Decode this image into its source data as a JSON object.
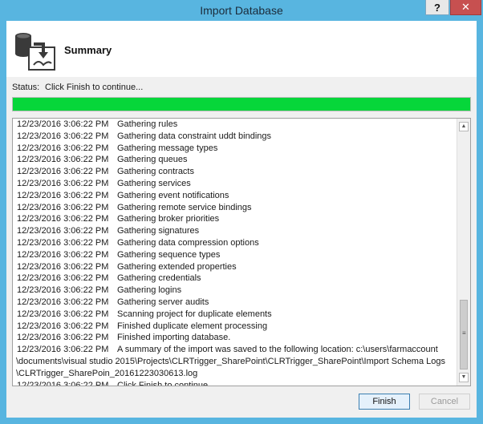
{
  "window": {
    "title": "Import Database",
    "help_label": "?",
    "close_label": "✕"
  },
  "header": {
    "title": "Summary",
    "icon": "database-import-icon"
  },
  "status": {
    "label": "Status:",
    "value": "Click Finish to continue...",
    "progress_percent": 100,
    "progress_color": "#06d63a"
  },
  "log": {
    "entries": [
      {
        "time": "12/23/2016 3:06:22 PM",
        "message": "Gathering rules"
      },
      {
        "time": "12/23/2016 3:06:22 PM",
        "message": "Gathering data constraint uddt bindings"
      },
      {
        "time": "12/23/2016 3:06:22 PM",
        "message": "Gathering message types"
      },
      {
        "time": "12/23/2016 3:06:22 PM",
        "message": "Gathering queues"
      },
      {
        "time": "12/23/2016 3:06:22 PM",
        "message": "Gathering contracts"
      },
      {
        "time": "12/23/2016 3:06:22 PM",
        "message": "Gathering services"
      },
      {
        "time": "12/23/2016 3:06:22 PM",
        "message": "Gathering event notifications"
      },
      {
        "time": "12/23/2016 3:06:22 PM",
        "message": "Gathering remote service bindings"
      },
      {
        "time": "12/23/2016 3:06:22 PM",
        "message": "Gathering broker priorities"
      },
      {
        "time": "12/23/2016 3:06:22 PM",
        "message": "Gathering signatures"
      },
      {
        "time": "12/23/2016 3:06:22 PM",
        "message": "Gathering data compression options"
      },
      {
        "time": "12/23/2016 3:06:22 PM",
        "message": "Gathering sequence types"
      },
      {
        "time": "12/23/2016 3:06:22 PM",
        "message": "Gathering extended properties"
      },
      {
        "time": "12/23/2016 3:06:22 PM",
        "message": "Gathering credentials"
      },
      {
        "time": "12/23/2016 3:06:22 PM",
        "message": "Gathering logins"
      },
      {
        "time": "12/23/2016 3:06:22 PM",
        "message": "Gathering server audits"
      },
      {
        "time": "12/23/2016 3:06:22 PM",
        "message": "Scanning project for duplicate elements"
      },
      {
        "time": "12/23/2016 3:06:22 PM",
        "message": "Finished duplicate element processing"
      },
      {
        "time": "12/23/2016 3:06:22 PM",
        "message": "Finished importing database."
      },
      {
        "time": "12/23/2016 3:06:22 PM",
        "message": "A summary of the import was saved to the following location: c:\\users\\farmaccount",
        "continuation": [
          "\\documents\\visual studio 2015\\Projects\\CLRTrigger_SharePoint\\CLRTrigger_SharePoint\\Import Schema Logs",
          "\\CLRTrigger_SharePoin_20161223030613.log"
        ]
      },
      {
        "time": "12/23/2016 3:06:22 PM",
        "message": "Click Finish to continue..."
      }
    ]
  },
  "buttons": {
    "finish": "Finish",
    "cancel": "Cancel"
  }
}
